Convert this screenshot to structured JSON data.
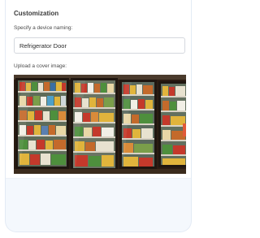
{
  "customization": {
    "title": "Customization",
    "naming_label": "Specify a device naming:",
    "device_name_value": "Refrigerator Door",
    "device_name_placeholder": "",
    "upload_label": "Upload a cover image:"
  },
  "cover_image": {
    "subject": "supermarket-fridge-doors",
    "colors": {
      "frame": "#3a2518",
      "glass_tint": "#6b7f6a",
      "shelf": "#d8d2c4",
      "accent_red": "#c4392b",
      "accent_yellow": "#e0b43c",
      "accent_green": "#4e8f3d"
    }
  }
}
